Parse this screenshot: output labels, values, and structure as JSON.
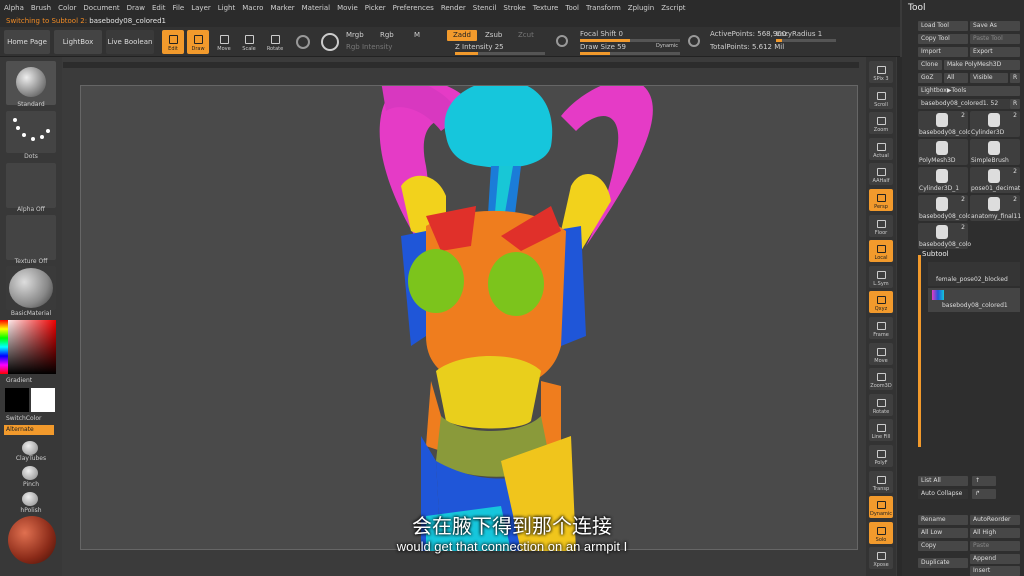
{
  "menu": [
    "Alpha",
    "Brush",
    "Color",
    "Document",
    "Draw",
    "Edit",
    "File",
    "Layer",
    "Light",
    "Macro",
    "Marker",
    "Material",
    "Movie",
    "Picker",
    "Preferences",
    "Render",
    "Stencil",
    "Stroke",
    "Texture",
    "Tool",
    "Transform",
    "Zplugin",
    "Zscript"
  ],
  "status": {
    "prefix": "Switching to Subtool 2:",
    "name": "basebody08_colored1"
  },
  "toolbar": {
    "home": "Home Page",
    "lightbox": "LightBox",
    "live_boolean": "Live Boolean",
    "edit": "Edit",
    "draw": "Draw",
    "move": "Move",
    "scale": "Scale",
    "rotate": "Rotate",
    "mrgb": "Mrgb",
    "rgb": "Rgb",
    "m": "M",
    "rgb_intensity": "Rgb Intensity",
    "zadd": "Zadd",
    "zsub": "Zsub",
    "zcut": "Zcut",
    "z_intensity": "Z Intensity 25",
    "focal_shift": "Focal Shift 0",
    "draw_size": "Draw Size 59",
    "dynamic": "Dynamic",
    "active_points": "ActivePoints: 568,960",
    "lazy_radius": "LazyRadius 1",
    "total_points": "TotalPoints: 5.612 Mil"
  },
  "left": {
    "standard": "Standard",
    "dots": "Dots",
    "alpha_off": "Alpha Off",
    "texture_off": "Texture Off",
    "material": "BasicMaterial",
    "gradient": "Gradient",
    "switch_color": "SwitchColor",
    "alternate": "Alternate",
    "brush1": "ClayTubes",
    "brush2": "Pinch",
    "brush3": "hPolish"
  },
  "dock": [
    "SPix 3",
    "Scroll",
    "Zoom",
    "Actual",
    "AAHalf",
    "Persp",
    "Floor",
    "Local",
    "L.Sym",
    "Qxyz",
    "Frame",
    "Move",
    "Zoom3D",
    "Rotate",
    "Line Fill",
    "PolyF",
    "Transp",
    "Dynamic",
    "Solo",
    "Xpose"
  ],
  "tool": {
    "title": "Tool",
    "load": "Load Tool",
    "save_as": "Save As",
    "copy": "Copy Tool",
    "paste": "Paste Tool",
    "import": "Import",
    "export": "Export",
    "clone": "Clone",
    "make_polymesh": "Make PolyMesh3D",
    "goz": "GoZ",
    "all": "All",
    "visible": "Visible",
    "r": "R",
    "lightbox_tools": "Lightbox▶Tools",
    "current": "basebody08_colored1. 52",
    "thumbs": [
      {
        "label": "basebody08_colo",
        "count": "2"
      },
      {
        "label": "Cylinder3D",
        "count": "2"
      },
      {
        "label": "PolyMesh3D",
        "count": ""
      },
      {
        "label": "SimpleBrush",
        "count": ""
      },
      {
        "label": "Cylinder3D_1",
        "count": ""
      },
      {
        "label": "pose01_decimat",
        "count": "2"
      },
      {
        "label": "basebody08_colo",
        "count": "2"
      },
      {
        "label": "anatomy_final11",
        "count": "2"
      },
      {
        "label": "basebody08_colo",
        "count": "2"
      }
    ],
    "subtool": "Subtool",
    "subtools": [
      "female_pose02_blocked",
      "basebody08_colored1"
    ],
    "list_all": "List All",
    "auto_collapse": "Auto Collapse",
    "rename": "Rename",
    "auto_reorder": "AutoReorder",
    "all_low": "All Low",
    "all_high": "All High",
    "copy2": "Copy",
    "paste2": "Paste",
    "duplicate": "Duplicate",
    "append": "Append",
    "insert": "Insert"
  },
  "subtitle": {
    "zh": "会在腋下得到那个连接",
    "en": "would get that connection on an armpit I"
  }
}
